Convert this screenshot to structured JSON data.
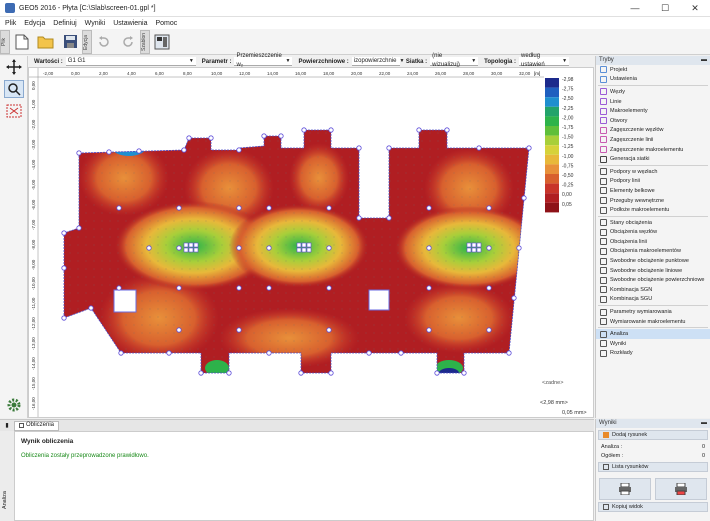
{
  "window": {
    "title": "GEO5 2016 - Płyta [C:\\Slab\\screen-01.gpl *]",
    "min": "—",
    "max": "☐",
    "close": "✕"
  },
  "menu": [
    "Plik",
    "Edycja",
    "Definiuj",
    "Wyniki",
    "Ustawienia",
    "Pomoc"
  ],
  "toolbar": {
    "tab_plik": "Plik",
    "tab_edycja": "Edycja",
    "tab_szablon": "Szablon"
  },
  "parambar": {
    "wartosci_label": "Wartości :",
    "wartosci_value": "G1 G1",
    "parametr_label": "Parametr :",
    "parametr_value": "Przemieszczenie w₂",
    "powierzchniowe_label": "Powierzchniowe :",
    "powierzchniowe_value": "izopowierzchnie",
    "siatka_label": "Siatka :",
    "siatka_value": "(nie wizualizuj)",
    "topologia_label": "Topologia :",
    "topologia_value": "według ustawień"
  },
  "axis": {
    "x_ticks": [
      "-2,00",
      "0,00",
      "2,00",
      "4,00",
      "6,00",
      "8,00",
      "10,00",
      "12,00",
      "14,00",
      "16,00",
      "18,00",
      "20,00",
      "22,00",
      "24,00",
      "26,00",
      "28,00",
      "30,00",
      "32,00"
    ],
    "x_unit": "[m]",
    "y_ticks": [
      "0,00",
      "-1,00",
      "-2,00",
      "-3,00",
      "-4,00",
      "-5,00",
      "-6,00",
      "-7,00",
      "-8,00",
      "-9,00",
      "-10,00",
      "-11,00",
      "-12,00",
      "-13,00",
      "-14,00",
      "-15,00",
      "-16,00"
    ]
  },
  "legend": {
    "values": [
      "-2,98",
      "-2,75",
      "-2,50",
      "-2,25",
      "-2,00",
      "-1,75",
      "-1,50",
      "-1,25",
      "-1,00",
      "-0,75",
      "-0,50",
      "-0,25",
      "0,00",
      "0,05"
    ],
    "colors": [
      "#1c2a8c",
      "#1f5fbf",
      "#1f8fcf",
      "#22a36a",
      "#2db34a",
      "#5fbf3a",
      "#a8cf3a",
      "#d6d23a",
      "#e8b83a",
      "#e8903a",
      "#d8602e",
      "#c8342a",
      "#b01e22",
      "#8e1218"
    ],
    "footer_left": "<2,98 mm>",
    "footer_right": "0,05 mm>"
  },
  "canvas_footer": {
    "dropdown": "<zadne>"
  },
  "panel": {
    "head": "Tryby",
    "sections": [
      [
        {
          "label": "Projekt",
          "icon": "#5b8fd6"
        },
        {
          "label": "Ustawienia",
          "icon": "#5b8fd6"
        }
      ],
      [
        {
          "label": "Węzły",
          "icon": "#9b5bd6"
        },
        {
          "label": "Linie",
          "icon": "#9b5bd6"
        },
        {
          "label": "Makroelementy",
          "icon": "#9b5bd6"
        },
        {
          "label": "Otwory",
          "icon": "#9b5bd6"
        },
        {
          "label": "Zagęszczenie węzłów",
          "icon": "#c85bb0"
        },
        {
          "label": "Zagęszczenie linii",
          "icon": "#c85bb0"
        },
        {
          "label": "Zagęszczenie makroelementu",
          "icon": "#c85bb0"
        },
        {
          "label": "Generacja siatki",
          "icon": "#444"
        }
      ],
      [
        {
          "label": "Podpory w węzłach",
          "icon": "#555"
        },
        {
          "label": "Podpory linii",
          "icon": "#555"
        },
        {
          "label": "Elementy belkowe",
          "icon": "#555"
        },
        {
          "label": "Przeguby wewnętrzne",
          "icon": "#555"
        },
        {
          "label": "Podłoże makroelementu",
          "icon": "#555"
        }
      ],
      [
        {
          "label": "Stany obciążenia",
          "icon": "#555"
        },
        {
          "label": "Obciążenia węzłów",
          "icon": "#555"
        },
        {
          "label": "Obciążenia linii",
          "icon": "#555"
        },
        {
          "label": "Obciążenia makroelementów",
          "icon": "#555"
        },
        {
          "label": "Swobodne obciążenie punktowe",
          "icon": "#555"
        },
        {
          "label": "Swobodne obciążenie liniowe",
          "icon": "#555"
        },
        {
          "label": "Swobodne obciążenie powierzchniowe",
          "icon": "#555"
        },
        {
          "label": "Kombinacja SGN",
          "icon": "#555"
        },
        {
          "label": "Kombinacja SGU",
          "icon": "#555"
        }
      ],
      [
        {
          "label": "Parametry wymiarowania",
          "icon": "#555"
        },
        {
          "label": "Wymiarowanie makroelementu",
          "icon": "#555"
        }
      ],
      [
        {
          "label": "Analiza",
          "icon": "#555",
          "active": true
        },
        {
          "label": "Wyniki",
          "icon": "#555"
        },
        {
          "label": "Rozkłady",
          "icon": "#555"
        }
      ]
    ]
  },
  "output": {
    "tab": "Obliczenia",
    "side_label": "Analiza",
    "title": "Wynik obliczenia",
    "message": "Obliczenia zostały przeprowadzone prawidłowo."
  },
  "results": {
    "head": "Wyniki",
    "add_label": "Dodaj rysunek",
    "analiza_label": "Analiza :",
    "analiza_value": "0",
    "ogolem_label": "Ogółem :",
    "ogolem_value": "0",
    "lista_label": "Lista rysunków",
    "kopiuj_label": "Kopiuj widok"
  }
}
